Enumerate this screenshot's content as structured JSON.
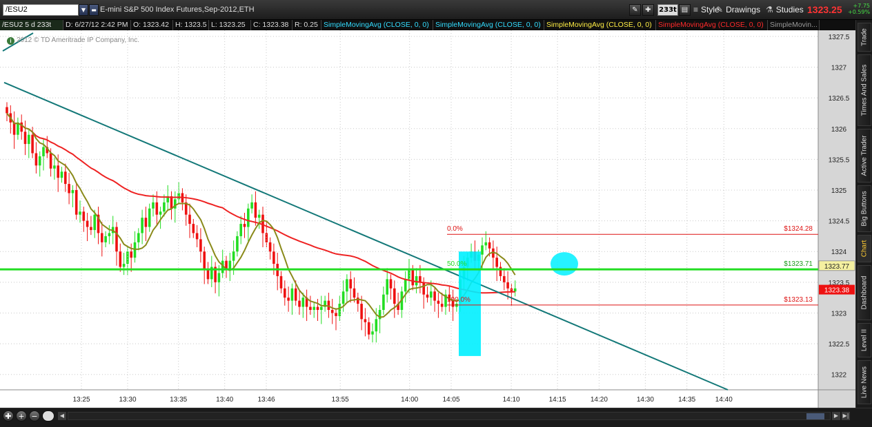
{
  "toolbar": {
    "symbol": "/ESU2",
    "description": "E-mini S&P 500 Index Futures,Sep-2012,ETH",
    "aggregation": "233t",
    "style_label": "Style",
    "drawings_label": "Drawings",
    "studies_label": "Studies",
    "last_price": "1323.25",
    "change_abs": "+7.75",
    "change_pct": "+0.59%"
  },
  "infobar": {
    "symbol_cell": "/ESU2 5 d 233t",
    "date_cell": "D: 6/27/12 2:42 PM",
    "open_cell": "O: 1323.42",
    "high_cell": "H: 1323.5",
    "low_cell": "L: 1323.25",
    "close_cell": "C: 1323.38",
    "range_cell": "R: 0.25",
    "studies": [
      {
        "label": "SimpleMovingAvg (CLOSE, 0, 0)",
        "color": "#33ddff"
      },
      {
        "label": "SimpleMovingAvg (CLOSE, 0, 0)",
        "color": "#33ddff"
      },
      {
        "label": "SimpleMovingAvg (CLOSE, 0, 0)",
        "color": "#ffee44"
      },
      {
        "label": "SimpleMovingAvg (CLOSE, 0, 0)",
        "color": "#ff2a2a"
      },
      {
        "label": "SimpleMovin...",
        "color": "#999999"
      }
    ]
  },
  "copyright": "2012 © TD Ameritrade IP Company, Inc.",
  "side_tabs": [
    {
      "label": "Trade",
      "active": false
    },
    {
      "label": "Times And Sales",
      "active": false
    },
    {
      "label": "Active Trader",
      "active": false
    },
    {
      "label": "Big Buttons",
      "active": false
    },
    {
      "label": "Chart",
      "active": true
    },
    {
      "label": "Dashboard",
      "active": false
    },
    {
      "label": "Level II",
      "active": false
    },
    {
      "label": "Live News",
      "active": false
    }
  ],
  "colors": {
    "up": "#22dd22",
    "down": "#ee1111",
    "sma_fast": "#8a8a1a",
    "sma_slow": "#ee2222",
    "trendline": "#137878",
    "fib": "#dd1111",
    "fib_mid": "#22dd22",
    "highlight": "#00f0ff",
    "grid": "#c8c8c8"
  },
  "chart_data": {
    "type": "candlestick",
    "ylim": [
      1321.75,
      1327.6
    ],
    "y_ticks": [
      "1322",
      "1322.5",
      "1323",
      "1323.5",
      "1324",
      "1324.5",
      "1325",
      "1325.5",
      "1326",
      "1326.5",
      "1327",
      "1327.5"
    ],
    "x_ticks": [
      "13:25",
      "13:30",
      "13:35",
      "13:40",
      "13:46",
      "13:55",
      "14:00",
      "14:05",
      "14:10",
      "14:15",
      "14:20",
      "14:30",
      "14:35",
      "14:40"
    ],
    "current_price_label": "1323.38",
    "sma_price_label": "1323.77",
    "fib_levels": [
      {
        "pct": "0.0%",
        "price": 1324.28,
        "label": "$1324.28"
      },
      {
        "pct": "50.0%",
        "price": 1323.71,
        "label": "$1323.71"
      },
      {
        "pct": "100.0%",
        "price": 1323.13,
        "label": "$1323.13"
      }
    ],
    "closes": [
      1326.25,
      1326.1,
      1325.9,
      1326.1,
      1325.95,
      1325.75,
      1325.9,
      1325.6,
      1325.4,
      1325.55,
      1325.7,
      1325.6,
      1325.35,
      1325.4,
      1325.2,
      1325.3,
      1325.1,
      1324.95,
      1325.0,
      1324.6,
      1324.65,
      1324.5,
      1324.4,
      1324.35,
      1324.6,
      1324.3,
      1324.15,
      1324.25,
      1324.3,
      1324.4,
      1324.0,
      1323.75,
      1323.8,
      1324.0,
      1323.9,
      1324.15,
      1324.3,
      1324.55,
      1324.4,
      1324.7,
      1324.8,
      1324.6,
      1324.65,
      1324.8,
      1324.9,
      1324.7,
      1324.85,
      1324.95,
      1324.8,
      1324.6,
      1324.45,
      1324.3,
      1324.2,
      1324.0,
      1323.7,
      1323.55,
      1323.75,
      1323.5,
      1323.65,
      1323.85,
      1323.7,
      1323.85,
      1324.0,
      1324.25,
      1324.45,
      1324.4,
      1324.7,
      1324.8,
      1324.55,
      1324.6,
      1324.3,
      1324.15,
      1324.0,
      1323.8,
      1323.6,
      1323.4,
      1323.25,
      1323.2,
      1323.4,
      1323.2,
      1323.1,
      1323.25,
      1323.1,
      1323.05,
      1323.1,
      1323.05,
      1323.1,
      1323.2,
      1323.05,
      1323.0,
      1322.95,
      1323.15,
      1323.35,
      1323.55,
      1323.4,
      1323.25,
      1323.15,
      1322.9,
      1322.85,
      1322.65,
      1322.7,
      1322.9,
      1323.05,
      1323.3,
      1323.55,
      1323.4,
      1323.15,
      1323.05,
      1323.35,
      1323.55,
      1323.7,
      1323.45,
      1323.6,
      1323.5,
      1323.3,
      1323.25,
      1323.35,
      1323.2,
      1323.15,
      1323.1,
      1323.3,
      1323.2,
      1323.1,
      1323.15,
      1323.55,
      1323.75,
      1323.9,
      1324.0,
      1323.85,
      1323.95,
      1324.1,
      1324.15,
      1324.05,
      1323.9,
      1323.75,
      1323.6,
      1323.5,
      1323.4,
      1323.35,
      1323.4
    ]
  }
}
